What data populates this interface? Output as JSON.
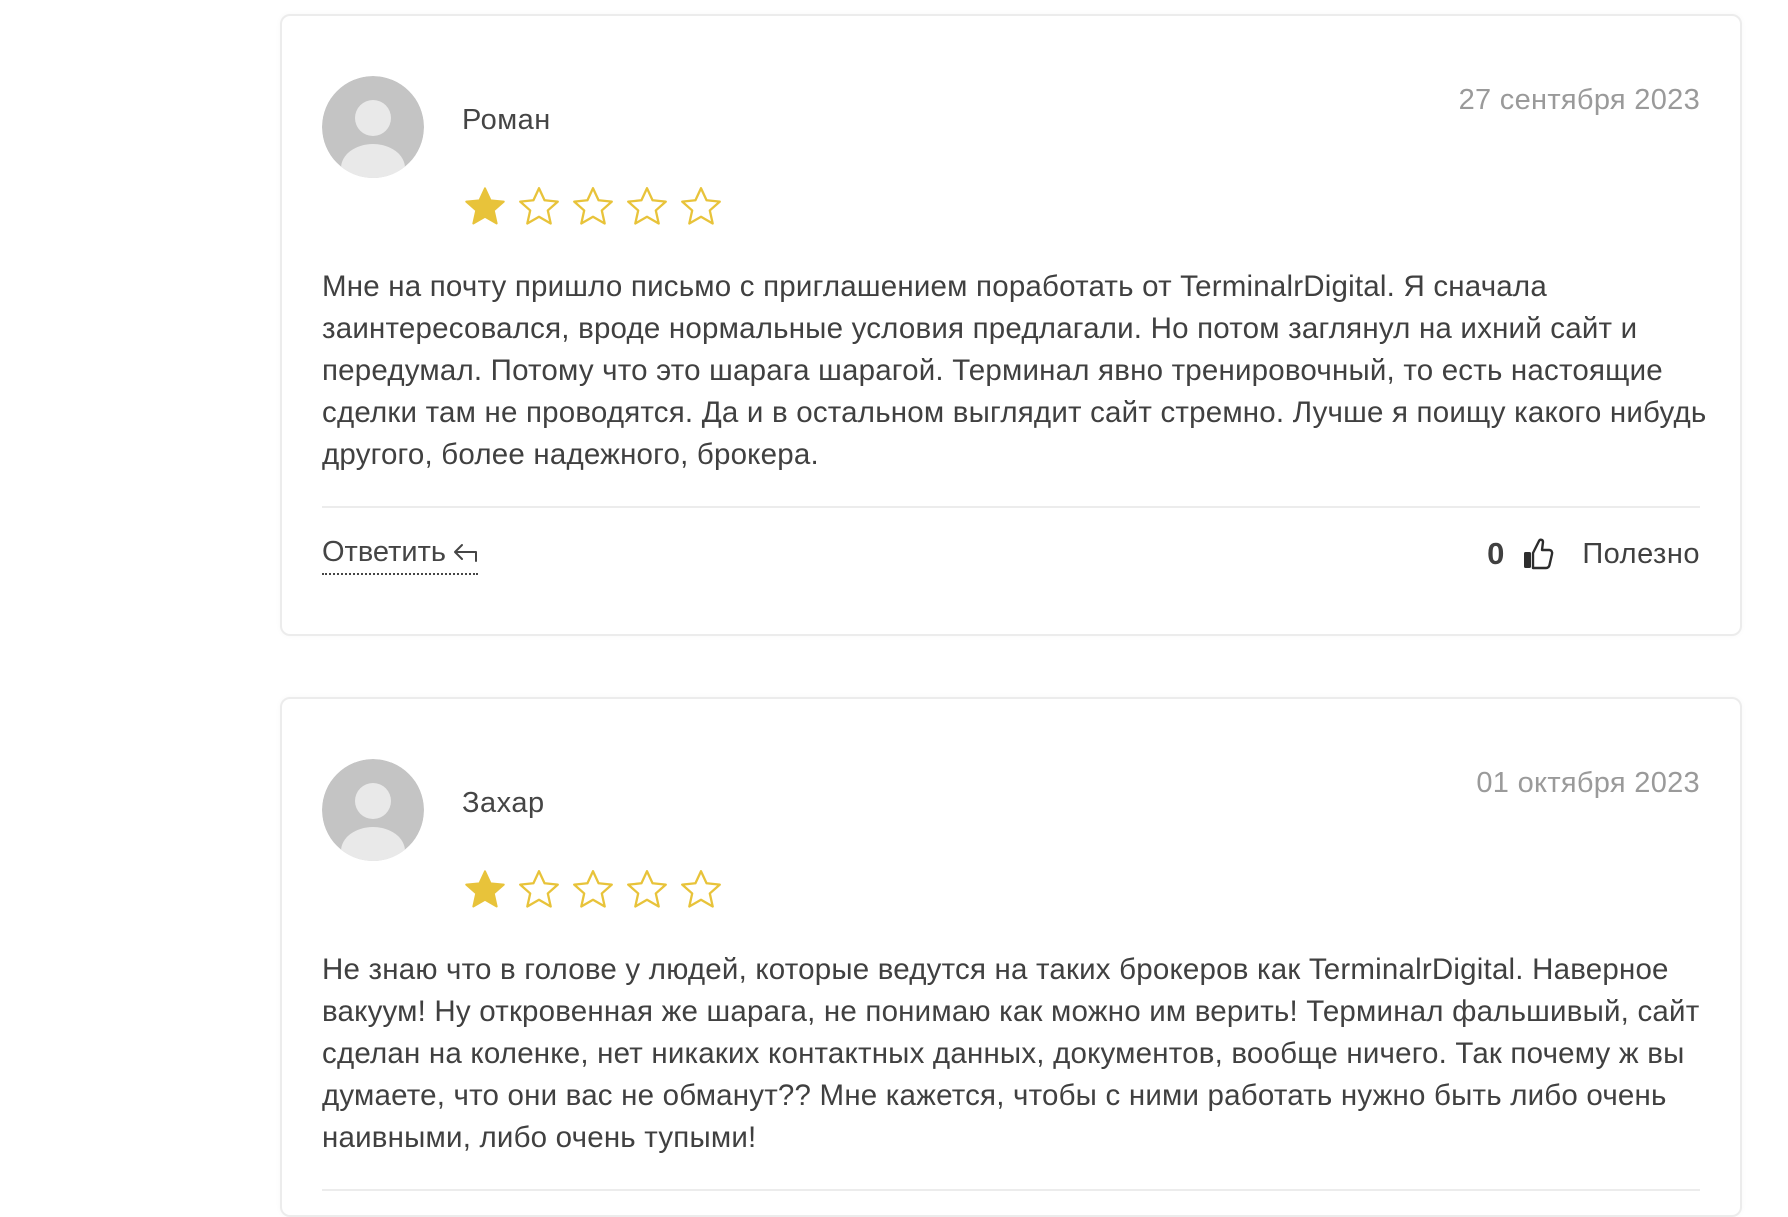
{
  "reviews": [
    {
      "author": "Роман",
      "date": "27 сентября 2023",
      "rating": 1,
      "max_rating": 5,
      "text": "Мне на почту пришло письмо с приглашением поработать от TerminalrDigital. Я сначала заинтересовался, вроде нормальные условия предлагали. Но потом заглянул на ихний сайт и передумал. Потому что это шарага шарагой. Терминал явно тренировочный, то есть настоящие сделки там не проводятся. Да и в остальном выглядит сайт стремно. Лучше я поищу какого нибудь другого, более надежного, брокера.",
      "reply_label": "Ответить",
      "useful_count": "0",
      "useful_label": "Полезно"
    },
    {
      "author": "Захар",
      "date": "01 октября 2023",
      "rating": 1,
      "max_rating": 5,
      "text": "Не знаю что в голове у людей, которые ведутся на таких брокеров как TerminalrDigital. Наверное вакуум! Ну откровенная же шарага, не понимаю как можно им верить! Терминал фальшивый, сайт сделан на коленке, нет никаких контактных данных, документов, вообще ничего. Так почему ж вы думаете, что они вас не обманут?? Мне кажется, чтобы с ними работать нужно быть либо очень наивными, либо очень тупыми!"
    }
  ],
  "icons": {
    "avatar": "default-user-avatar-icon",
    "star_filled": "star-filled-icon",
    "star_empty": "star-outline-icon",
    "reply": "reply-arrow-icon",
    "like": "thumbs-up-icon"
  },
  "colors": {
    "star": "#E8C33A",
    "text": "#404040",
    "date": "#9A9A9A",
    "border": "#ECECEC"
  }
}
